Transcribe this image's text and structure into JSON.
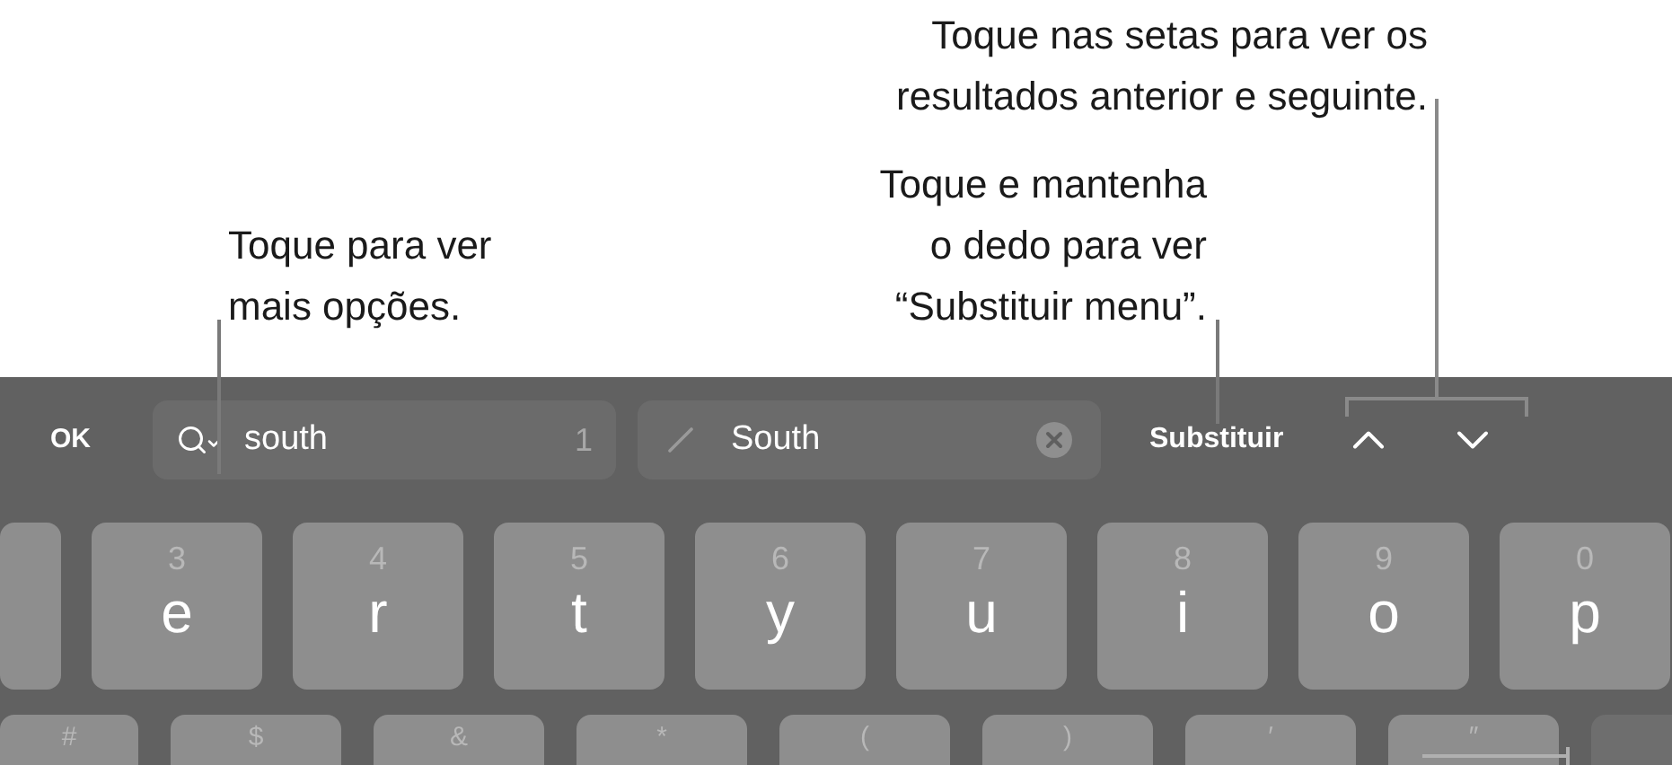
{
  "callouts": [
    {
      "text": "Toque nas setas para ver os\nresultados anterior e seguinte."
    },
    {
      "text": "Toque para ver\nmais opções."
    },
    {
      "text": "Toque e mantenha\no dedo para ver\n“Substituir menu”."
    }
  ],
  "find_bar": {
    "done_button": "OK",
    "search_field": {
      "value": "south",
      "match_count": "1"
    },
    "replace_field": {
      "value": "South"
    },
    "replace_button": "Substituir"
  },
  "keyboard": {
    "rows": [
      [
        {
          "kind": "blank"
        },
        {
          "kind": "letter",
          "hint": "3",
          "label": "e"
        },
        {
          "kind": "letter",
          "hint": "4",
          "label": "r"
        },
        {
          "kind": "letter",
          "hint": "5",
          "label": "t"
        },
        {
          "kind": "letter",
          "hint": "6",
          "label": "y"
        },
        {
          "kind": "letter",
          "hint": "7",
          "label": "u"
        },
        {
          "kind": "letter",
          "hint": "8",
          "label": "i"
        },
        {
          "kind": "letter",
          "hint": "9",
          "label": "o"
        },
        {
          "kind": "letter",
          "hint": "0",
          "label": "p"
        }
      ],
      [
        {
          "kind": "letter",
          "hint": "#"
        },
        {
          "kind": "letter",
          "hint": "$"
        },
        {
          "kind": "letter",
          "hint": "&"
        },
        {
          "kind": "letter",
          "hint": "*"
        },
        {
          "kind": "letter",
          "hint": "("
        },
        {
          "kind": "letter",
          "hint": ")"
        },
        {
          "kind": "letter",
          "hint": "′"
        },
        {
          "kind": "letter",
          "hint": "″"
        },
        {
          "kind": "dark"
        }
      ]
    ]
  }
}
